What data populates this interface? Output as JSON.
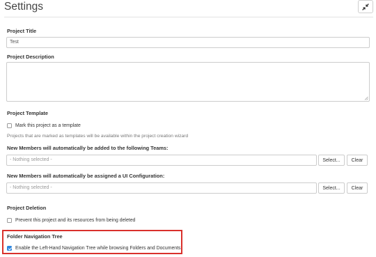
{
  "header": {
    "title": "Settings",
    "collapse_icon": "collapse-arrows-icon"
  },
  "project_title": {
    "label": "Project Title",
    "value": "Test"
  },
  "project_description": {
    "label": "Project Description",
    "value": ""
  },
  "project_template": {
    "label": "Project Template",
    "checkbox_label": "Mark this project as a template",
    "checked": false,
    "help": "Projects that are marked as templates will be available within the project creation wizard"
  },
  "teams": {
    "label": "New Members will automatically be added to the following Teams:",
    "placeholder": "- Nothing selected -",
    "select_button": "Select...",
    "clear_button": "Clear"
  },
  "ui_config": {
    "label": "New Members will automatically be assigned a UI Configuration:",
    "placeholder": "- Nothing selected -",
    "select_button": "Select...",
    "clear_button": "Clear"
  },
  "project_deletion": {
    "label": "Project Deletion",
    "checkbox_label": "Prevent this project and its resources from being deleted",
    "checked": false
  },
  "folder_nav": {
    "label": "Folder Navigation Tree",
    "checkbox_label": "Enable the Left-Hand Navigation Tree while browsing Folders and Documents",
    "checked": true,
    "highlight_color": "#d9302b"
  },
  "colors": {
    "checkbox_checked": "#2e86de",
    "border": "#cccccc"
  }
}
